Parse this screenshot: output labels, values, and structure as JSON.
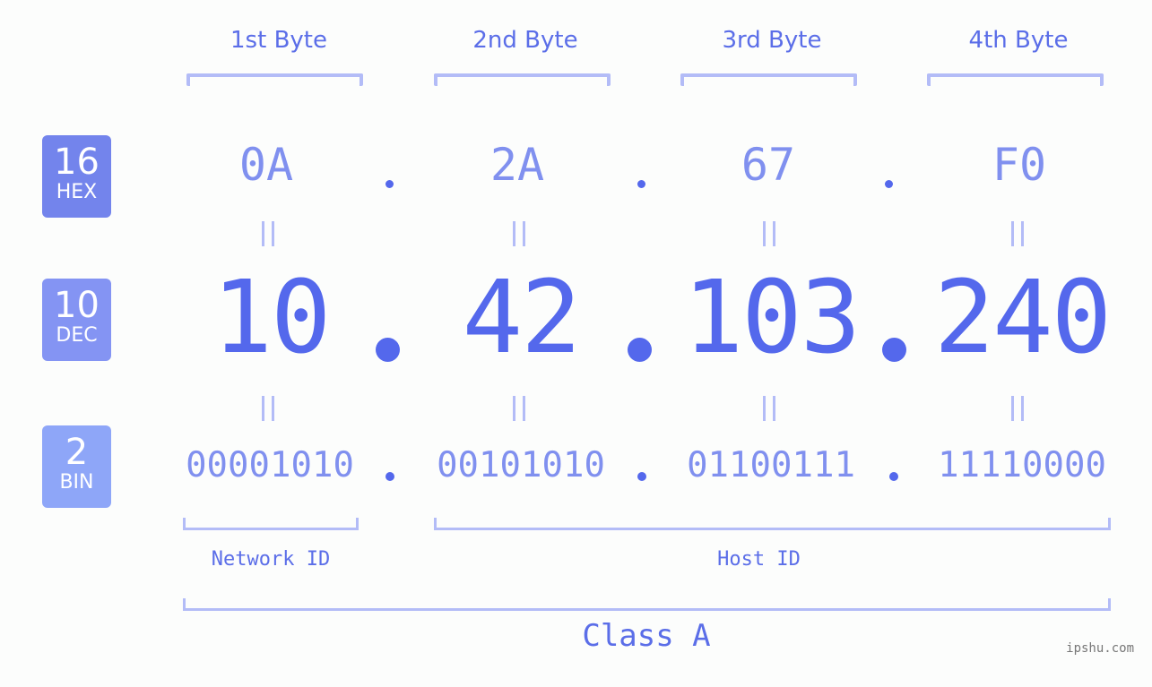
{
  "bytes": [
    {
      "label": "1st Byte",
      "hex": "0A",
      "dec": "10",
      "bin": "00001010"
    },
    {
      "label": "2nd Byte",
      "hex": "2A",
      "dec": "42",
      "bin": "00101010"
    },
    {
      "label": "3rd Byte",
      "hex": "67",
      "dec": "103",
      "bin": "01100111"
    },
    {
      "label": "4th Byte",
      "hex": "F0",
      "dec": "240",
      "bin": "11110000"
    }
  ],
  "badges": {
    "hex": {
      "num": "16",
      "label": "HEX",
      "color": "#7384ec"
    },
    "dec": {
      "num": "10",
      "label": "DEC",
      "color": "#8494f3"
    },
    "bin": {
      "num": "2",
      "label": "BIN",
      "color": "#8ea6f8"
    }
  },
  "ids": {
    "network": "Network ID",
    "host": "Host ID"
  },
  "class_label": "Class A",
  "watermark": "ipshu.com",
  "colors": {
    "accent": "#5468ec",
    "light": "#8090ef",
    "bracket": "#b3bcf7"
  }
}
